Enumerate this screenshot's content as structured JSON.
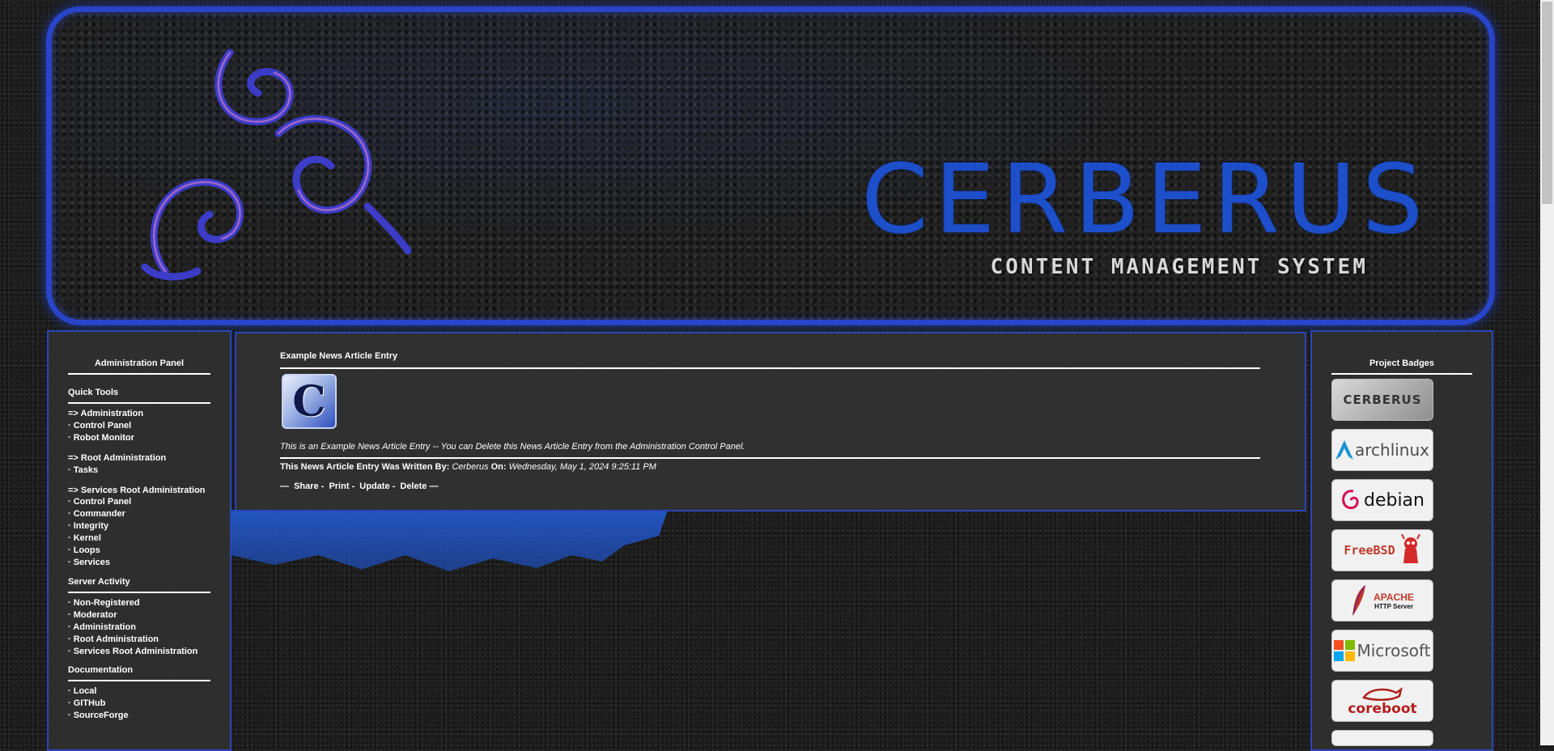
{
  "banner": {
    "title": "CERBERUS",
    "subtitle": "CONTENT MANAGEMENT SYSTEM",
    "accent": "#2844c8",
    "logo": "swirl-triskelion-icon"
  },
  "left_panel": {
    "title": "Administration Panel",
    "sections": [
      {
        "heading": "Quick Tools",
        "groups": [
          [
            "=> Administration",
            "· Control Panel",
            "· Robot Monitor"
          ],
          [
            "=> Root Administration",
            "· Tasks"
          ],
          [
            "=> Services Root Administration",
            "· Control Panel",
            "· Commander",
            "· Integrity",
            "· Kernel",
            "· Loops",
            "· Services"
          ]
        ]
      },
      {
        "heading": "Server Activity",
        "groups": [
          [
            "· Non-Registered",
            "· Moderator",
            "· Administration",
            "· Root Administration",
            "· Services Root Administration"
          ]
        ]
      },
      {
        "heading": "Documentation",
        "groups": [
          [
            "· Local",
            "· GITHub",
            "· SourceForge"
          ]
        ]
      }
    ]
  },
  "article": {
    "title": "Example News Article Entry",
    "thumb_letter": "C",
    "body": "This is an Example News Article Entry -- You can Delete this News Article Entry from the Administration Control Panel.",
    "byline_prefix": "This News Article Entry Was Written By:",
    "author": "Cerberus",
    "on_label": "On:",
    "date": "Wednesday, May 1, 2024 9:25:11 PM",
    "actions": {
      "lead": "—",
      "share": "Share",
      "print": "Print",
      "update": "Update",
      "delete": "Delete",
      "sep": "-",
      "tail": "—"
    }
  },
  "right_panel": {
    "title": "Project Badges",
    "badges": [
      {
        "name": "cerberus",
        "text": "CERBERUS",
        "color": "#333333"
      },
      {
        "name": "archlinux",
        "text": "archlinux",
        "color": "#1793d1"
      },
      {
        "name": "debian",
        "text": "debian",
        "color": "#222222"
      },
      {
        "name": "freebsd",
        "text": "FreeBSD",
        "color": "#c0392b"
      },
      {
        "name": "apache",
        "text": "APACHE",
        "text2": "HTTP Server",
        "color": "#c0392b"
      },
      {
        "name": "microsoft",
        "text": "Microsoft",
        "color": "#555555"
      },
      {
        "name": "coreboot",
        "text": "coreboot",
        "color": "#b01e1e"
      }
    ]
  }
}
